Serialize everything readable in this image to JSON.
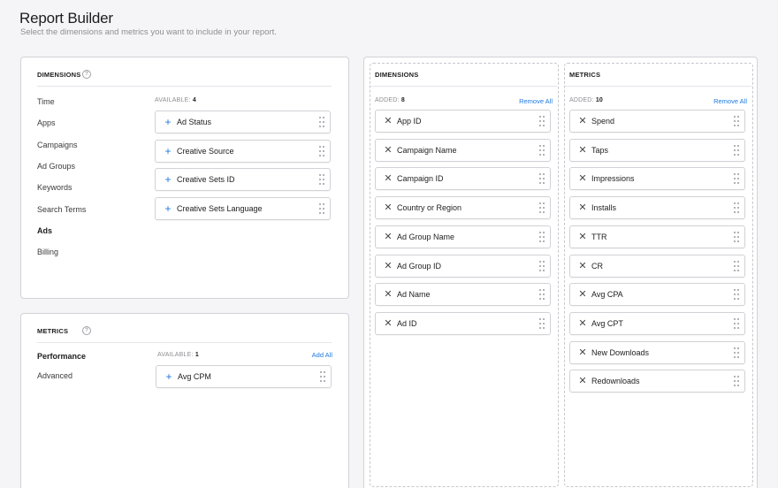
{
  "header": {
    "title": "Report Builder",
    "subtitle": "Select the dimensions and metrics you want to include in your report."
  },
  "icons": {
    "help": "help-circle-icon",
    "add": "plus-icon",
    "remove": "x-icon",
    "drag": "drag-handle-icon"
  },
  "colors": {
    "accent": "#1f7ae0",
    "border": "#d2d2d7",
    "background": "#f5f5f7"
  },
  "dimensions_panel": {
    "title": "DIMENSIONS",
    "help": "?",
    "categories": [
      "Time",
      "Apps",
      "Campaigns",
      "Ad Groups",
      "Keywords",
      "Search Terms",
      "Ads",
      "Billing"
    ],
    "active_category": "Ads",
    "available_label": "AVAILABLE:",
    "available_count": "4",
    "items": [
      "Ad Status",
      "Creative Source",
      "Creative Sets ID",
      "Creative Sets Language"
    ]
  },
  "metrics_panel": {
    "title": "METRICS",
    "help": "?",
    "categories": [
      "Performance",
      "Advanced"
    ],
    "active_category": "Performance",
    "available_label": "AVAILABLE:",
    "available_count": "1",
    "add_all": "Add All",
    "items": [
      "Avg CPM"
    ]
  },
  "added_dimensions": {
    "title": "DIMENSIONS",
    "added_label": "ADDED:",
    "added_count": "8",
    "remove_all": "Remove All",
    "items": [
      "App ID",
      "Campaign Name",
      "Campaign ID",
      "Country or Region",
      "Ad Group Name",
      "Ad Group ID",
      "Ad Name",
      "Ad ID"
    ]
  },
  "added_metrics": {
    "title": "METRICS",
    "added_label": "ADDED:",
    "added_count": "10",
    "remove_all": "Remove All",
    "items": [
      "Spend",
      "Taps",
      "Impressions",
      "Installs",
      "TTR",
      "CR",
      "Avg CPA",
      "Avg CPT",
      "New Downloads",
      "Redownloads"
    ]
  }
}
